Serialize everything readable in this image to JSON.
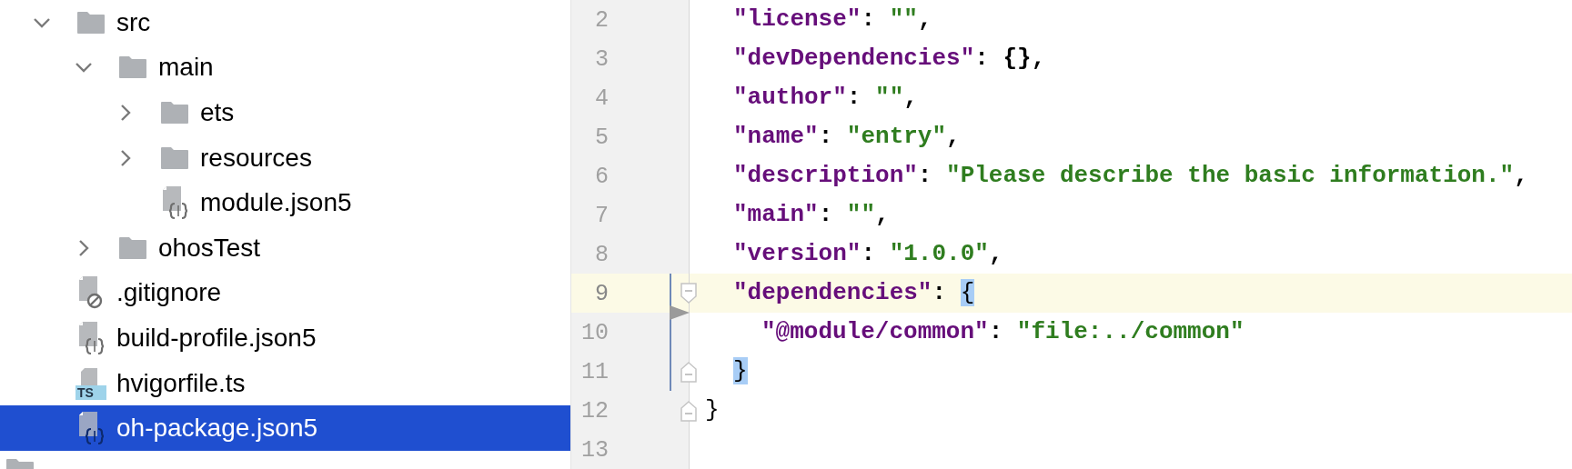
{
  "project_tree": {
    "items": [
      {
        "kind": "folder",
        "label": "src",
        "expanded": true,
        "selected": false,
        "children": [
          {
            "kind": "folder",
            "label": "main",
            "expanded": true,
            "selected": false,
            "children": [
              {
                "kind": "folder",
                "label": "ets",
                "expanded": false,
                "selected": false
              },
              {
                "kind": "folder",
                "label": "resources",
                "expanded": false,
                "selected": false
              },
              {
                "kind": "json",
                "label": "module.json5",
                "selected": false
              }
            ]
          },
          {
            "kind": "folder",
            "label": "ohosTest",
            "expanded": false,
            "selected": false
          }
        ]
      },
      {
        "kind": "ignore",
        "label": ".gitignore",
        "selected": false
      },
      {
        "kind": "json",
        "label": "build-profile.json5",
        "selected": false
      },
      {
        "kind": "ts",
        "label": "hvigorfile.ts",
        "icon_text": "TS",
        "selected": false
      },
      {
        "kind": "json",
        "label": "oh-package.json5",
        "selected": true
      }
    ],
    "next_item": {
      "kind": "folder"
    }
  },
  "editor": {
    "lines": [
      {
        "number": "2",
        "kind": "member",
        "current": false,
        "changed": false,
        "tokens": [
          {
            "kind": "key",
            "text": "\"license\""
          },
          {
            "kind": "punct",
            "text": ": "
          },
          {
            "kind": "string",
            "text": "\"\""
          },
          {
            "kind": "punct",
            "text": ","
          }
        ]
      },
      {
        "number": "3",
        "kind": "member",
        "current": false,
        "changed": false,
        "tokens": [
          {
            "kind": "key",
            "text": "\"devDependencies\""
          },
          {
            "kind": "punct",
            "text": ": {},"
          }
        ]
      },
      {
        "number": "4",
        "kind": "member",
        "current": false,
        "changed": false,
        "tokens": [
          {
            "kind": "key",
            "text": "\"author\""
          },
          {
            "kind": "punct",
            "text": ": "
          },
          {
            "kind": "string",
            "text": "\"\""
          },
          {
            "kind": "punct",
            "text": ","
          }
        ]
      },
      {
        "number": "5",
        "kind": "member",
        "current": false,
        "changed": false,
        "tokens": [
          {
            "kind": "key",
            "text": "\"name\""
          },
          {
            "kind": "punct",
            "text": ": "
          },
          {
            "kind": "string",
            "text": "\"entry\""
          },
          {
            "kind": "punct",
            "text": ","
          }
        ]
      },
      {
        "number": "6",
        "kind": "member",
        "current": false,
        "changed": false,
        "tokens": [
          {
            "kind": "key",
            "text": "\"description\""
          },
          {
            "kind": "punct",
            "text": ": "
          },
          {
            "kind": "string",
            "text": "\"Please describe the basic information.\""
          },
          {
            "kind": "punct",
            "text": ","
          }
        ]
      },
      {
        "number": "7",
        "kind": "member",
        "current": false,
        "changed": false,
        "tokens": [
          {
            "kind": "key",
            "text": "\"main\""
          },
          {
            "kind": "punct",
            "text": ": "
          },
          {
            "kind": "string",
            "text": "\"\""
          },
          {
            "kind": "punct",
            "text": ","
          }
        ]
      },
      {
        "number": "8",
        "kind": "member",
        "current": false,
        "changed": false,
        "tokens": [
          {
            "kind": "key",
            "text": "\"version\""
          },
          {
            "kind": "punct",
            "text": ": "
          },
          {
            "kind": "string",
            "text": "\"1.0.0\""
          },
          {
            "kind": "punct",
            "text": ","
          }
        ]
      },
      {
        "number": "9",
        "kind": "member",
        "current": true,
        "changed": true,
        "deleted_below": true,
        "fold_start": true,
        "tokens": [
          {
            "kind": "key",
            "text": "\"dependencies\""
          },
          {
            "kind": "punct",
            "text": ": "
          },
          {
            "kind": "bracket",
            "text": "{",
            "matched": true
          }
        ]
      },
      {
        "number": "10",
        "kind": "nested",
        "current": false,
        "changed": true,
        "tokens": [
          {
            "kind": "key",
            "text": "\"@module/common\""
          },
          {
            "kind": "punct",
            "text": ": "
          },
          {
            "kind": "string",
            "text": "\"file:../common\""
          }
        ]
      },
      {
        "number": "11",
        "kind": "member",
        "current": false,
        "changed": true,
        "fold_end": true,
        "tokens": [
          {
            "kind": "bracket",
            "text": "}",
            "matched": true
          }
        ]
      },
      {
        "number": "12",
        "kind": "root",
        "current": false,
        "changed": false,
        "fold_end": true,
        "tokens": [
          {
            "kind": "bracket",
            "text": "}",
            "matched": false
          }
        ]
      },
      {
        "number": "13",
        "kind": "root",
        "current": false,
        "changed": false
      }
    ]
  }
}
